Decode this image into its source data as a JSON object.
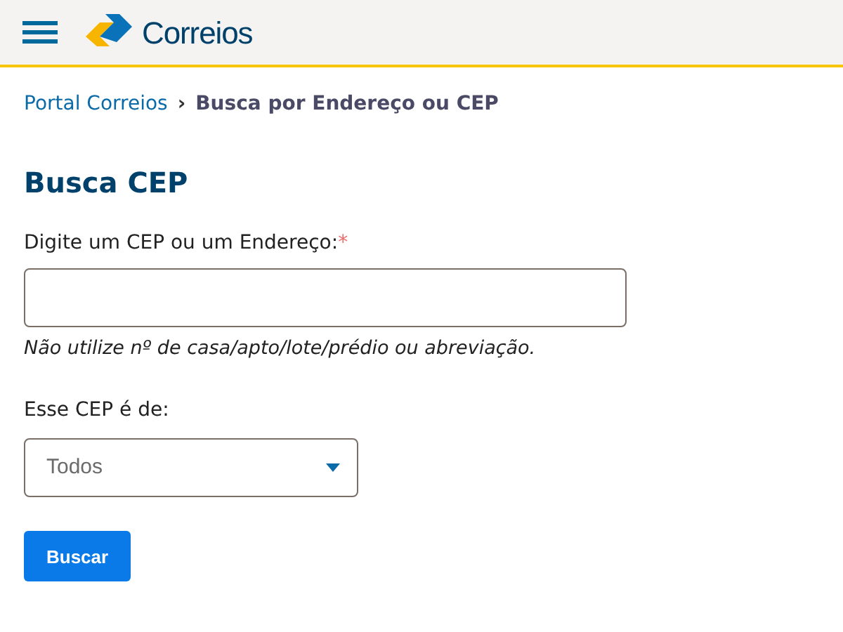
{
  "header": {
    "logo_text": "Correios"
  },
  "breadcrumb": [
    {
      "label": "Portal Correios",
      "kind": "link"
    },
    {
      "label": "›",
      "kind": "separator"
    },
    {
      "label": "Busca por Endereço ou CEP",
      "kind": "current"
    }
  ],
  "title": "Busca CEP",
  "address_field": {
    "label": "Digite um CEP ou um Endereço:",
    "required_mark": "*",
    "hint": "Não utilize nº de casa/apto/lote/prédio ou abreviação."
  },
  "type_select": {
    "label": "Esse CEP é de:",
    "value": "Todos"
  },
  "buttons": [
    "Buscar"
  ]
}
